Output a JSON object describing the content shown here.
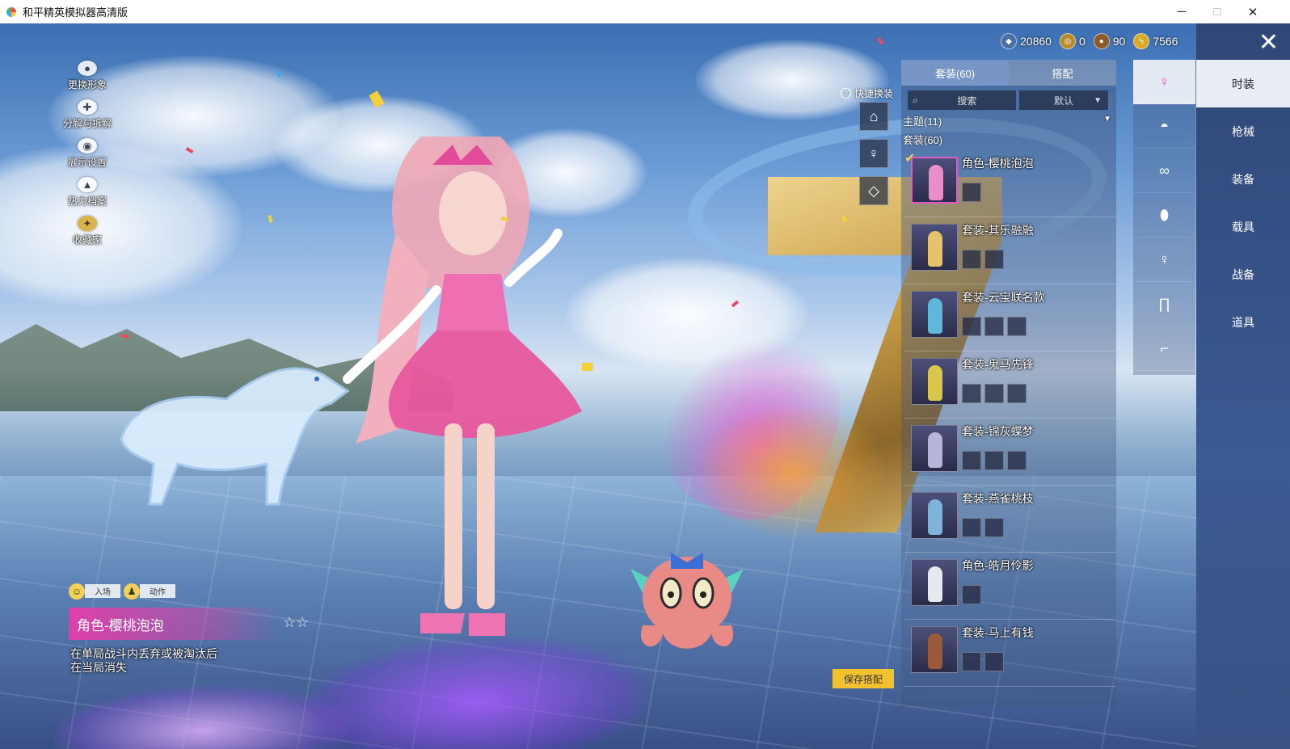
{
  "window": {
    "title": "和平精英模拟器高清版"
  },
  "left_menu": [
    {
      "label": "更换形象",
      "icon": "person-icon"
    },
    {
      "label": "分解与拆解",
      "icon": "gear-icon"
    },
    {
      "label": "展示设置",
      "icon": "eye-icon"
    },
    {
      "label": "热力档案",
      "icon": "flame-icon"
    },
    {
      "label": "收藏家",
      "icon": "medal-icon"
    }
  ],
  "mini_tabs": {
    "entrance": "入场",
    "action": "动作"
  },
  "outfit_info": {
    "name": "角色-樱桃泡泡",
    "description": "在单局战斗内丢弃或被淘汰后在当局消失"
  },
  "currencies": [
    {
      "icon": "diamond-coin-icon",
      "amount": "20860",
      "color": "#4a6fa5"
    },
    {
      "icon": "gold-token-icon",
      "amount": "0",
      "color": "#b88a2a"
    },
    {
      "icon": "bronze-coin-icon",
      "amount": "90",
      "color": "#8a5a2b"
    },
    {
      "icon": "lightning-coin-icon",
      "amount": "7566",
      "color": "#d9a92a"
    }
  ],
  "quick_change": {
    "label": "快捷换装"
  },
  "outfit_panel": {
    "tabs": [
      "套装(60)",
      "搭配"
    ],
    "search_placeholder": "搜索",
    "sort_value": "默认",
    "theme_label": "主题(11)",
    "count_label": "套装(60)",
    "items": [
      {
        "name": "角色-樱桃泡泡",
        "parts": 1,
        "color": "#e98fc6"
      },
      {
        "name": "套装-其乐融融",
        "parts": 2,
        "color": "#e6c26a"
      },
      {
        "name": "套装-云宝联名款",
        "parts": 3,
        "color": "#5fb7d9"
      },
      {
        "name": "套装-鬼马先锋",
        "parts": 3,
        "color": "#d9c64a"
      },
      {
        "name": "套装-锦灰蝶梦",
        "parts": 3,
        "color": "#b9b4d9"
      },
      {
        "name": "套装-燕雀桃枝",
        "parts": 2,
        "color": "#7fb3d9"
      },
      {
        "name": "角色-皓月伶影",
        "parts": 1,
        "color": "#e8e8f0"
      },
      {
        "name": "套装-马上有钱",
        "parts": 2,
        "color": "#9a5a3a"
      }
    ]
  },
  "save_button": "保存搭配",
  "icon_tabs": [
    "full-outfit-icon",
    "cap-icon",
    "glasses-icon",
    "mask-icon",
    "outfit-icon",
    "pants-icon",
    "shoes-icon"
  ],
  "categories": [
    "时装",
    "枪械",
    "装备",
    "载具",
    "战备",
    "道具"
  ],
  "colors": {
    "accent_pink": "#e05ac8",
    "save_yellow": "#f1c22e",
    "nav_blue": "#2f4778"
  }
}
